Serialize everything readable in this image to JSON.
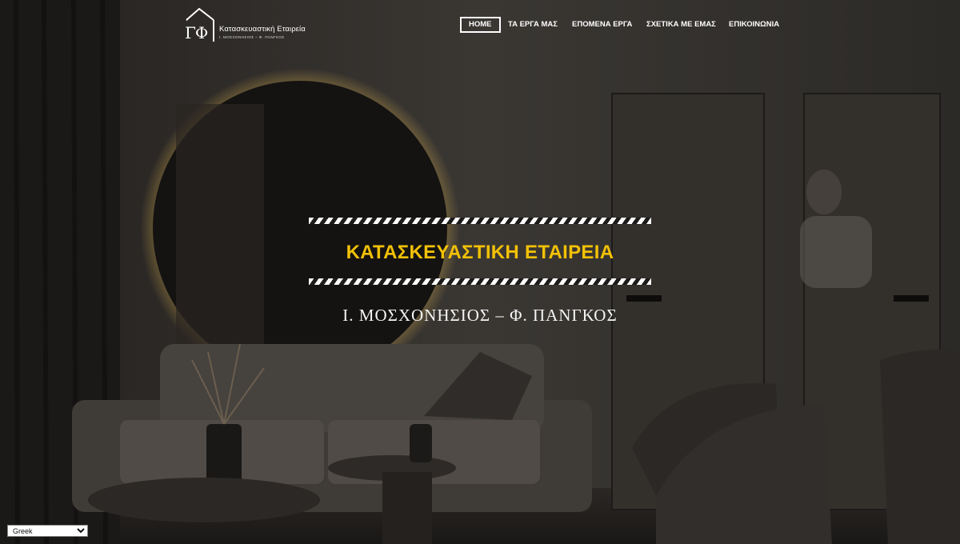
{
  "brand": {
    "monogram": "ΓΦ",
    "title": "Κατασκευαστική Εταιρεία",
    "subtitle": "Ι. ΜΟΣΧΟΝΗΣΙΟΣ – Φ. ΠΑΝΓΚΟΣ"
  },
  "nav": {
    "items": [
      {
        "label": "HOME",
        "active": true
      },
      {
        "label": "ΤΑ ΕΡΓΑ ΜΑΣ"
      },
      {
        "label": "ΕΠΟΜΕΝΑ ΕΡΓΑ"
      },
      {
        "label": "ΣΧΕΤΙΚΑ ΜΕ ΕΜΑΣ"
      },
      {
        "label": "ΕΠΙΚΟΙΝΩΝΙΑ"
      }
    ]
  },
  "hero": {
    "title": "ΚΑΤΑΣΚΕΥΑΣΤΙΚΗ ΕΤΑΙΡΕΙΑ",
    "subtitle": "Ι. ΜΟΣΧΟΝΗΣΙΟΣ – Φ. ΠΑΝΓΚΟΣ",
    "background": "dark living room interior with round backlit mirror"
  },
  "language": {
    "selected": "Greek"
  },
  "colors": {
    "accent": "#f2c106",
    "overlay": "#1d1c1a",
    "text": "#ffffff"
  }
}
